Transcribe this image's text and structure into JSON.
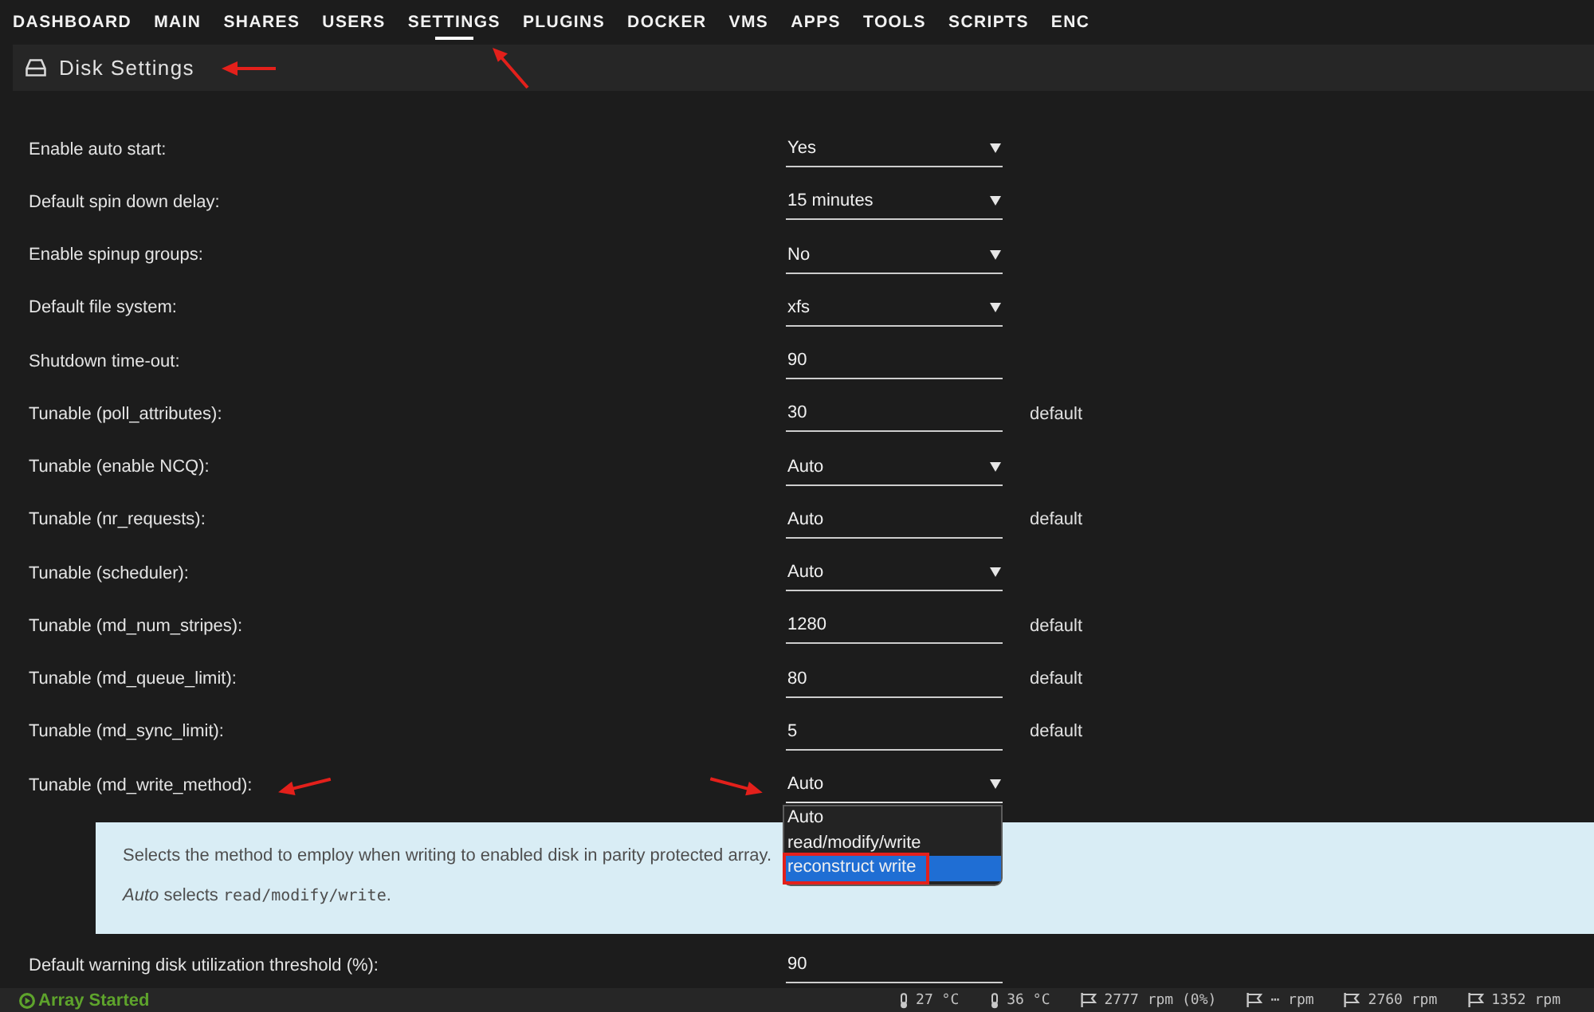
{
  "nav": {
    "items": [
      {
        "label": "DASHBOARD",
        "selected": false,
        "annotated": false
      },
      {
        "label": "MAIN",
        "selected": false,
        "annotated": false
      },
      {
        "label": "SHARES",
        "selected": false,
        "annotated": false
      },
      {
        "label": "USERS",
        "selected": false,
        "annotated": false
      },
      {
        "label": "SETTINGS",
        "selected": true,
        "annotated": true
      },
      {
        "label": "PLUGINS",
        "selected": false,
        "annotated": false
      },
      {
        "label": "DOCKER",
        "selected": false,
        "annotated": false
      },
      {
        "label": "VMS",
        "selected": false,
        "annotated": false
      },
      {
        "label": "APPS",
        "selected": false,
        "annotated": false
      },
      {
        "label": "TOOLS",
        "selected": false,
        "annotated": false
      },
      {
        "label": "SCRIPTS",
        "selected": false,
        "annotated": false
      },
      {
        "label": "ENC",
        "selected": false,
        "annotated": false
      }
    ]
  },
  "page_title": {
    "text": "Disk Settings",
    "annotated": true
  },
  "settings": [
    {
      "kind": "select",
      "label": "Enable auto start:",
      "value": "Yes",
      "expanded": false,
      "annotated": false
    },
    {
      "kind": "select",
      "label": "Default spin down delay:",
      "value": "15 minutes",
      "expanded": false,
      "annotated": false
    },
    {
      "kind": "select",
      "label": "Enable spinup groups:",
      "value": "No",
      "expanded": false,
      "annotated": false
    },
    {
      "kind": "select",
      "label": "Default file system:",
      "value": "xfs",
      "expanded": false,
      "annotated": false
    },
    {
      "kind": "text",
      "label": "Shutdown time-out:",
      "value": "90",
      "annotated": false
    },
    {
      "kind": "text",
      "label": "Tunable (poll_attributes):",
      "value": "30",
      "note": "default",
      "annotated": false
    },
    {
      "kind": "select",
      "label": "Tunable (enable NCQ):",
      "value": "Auto",
      "expanded": false,
      "annotated": false
    },
    {
      "kind": "text",
      "label": "Tunable (nr_requests):",
      "value": "Auto",
      "note": "default",
      "annotated": false
    },
    {
      "kind": "select",
      "label": "Tunable (scheduler):",
      "value": "Auto",
      "expanded": false,
      "annotated": false
    },
    {
      "kind": "text",
      "label": "Tunable (md_num_stripes):",
      "value": "1280",
      "note": "default",
      "annotated": false
    },
    {
      "kind": "text",
      "label": "Tunable (md_queue_limit):",
      "value": "80",
      "note": "default",
      "annotated": false
    },
    {
      "kind": "text",
      "label": "Tunable (md_sync_limit):",
      "value": "5",
      "note": "default",
      "annotated": false
    },
    {
      "kind": "select",
      "label": "Tunable (md_write_method):",
      "value": "Auto",
      "expanded": true,
      "annotated": true,
      "options": [
        {
          "label": "Auto",
          "highlighted": false,
          "annotated": false
        },
        {
          "label": "read/modify/write",
          "highlighted": false,
          "annotated": false
        },
        {
          "label": "reconstruct write",
          "highlighted": true,
          "annotated": true
        }
      ],
      "help": {
        "paragraphs": [
          {
            "parts": [
              {
                "kind": "plain",
                "text": "Selects the method to employ when writing to enabled disk in parity protected array."
              }
            ]
          },
          {
            "parts": [
              {
                "kind": "emphasis",
                "text": "Auto"
              },
              {
                "kind": "plain",
                "text": " selects "
              },
              {
                "kind": "code",
                "text": "read/modify/write"
              },
              {
                "kind": "plain",
                "text": "."
              }
            ]
          }
        ]
      }
    },
    {
      "kind": "text",
      "label": "Default warning disk utilization threshold (%):",
      "value": "90",
      "annotated": false
    }
  ],
  "status_bar": {
    "array_state": "Array Started",
    "sensors": [
      {
        "kind": "temperature",
        "reading": "27 °C"
      },
      {
        "kind": "temperature",
        "reading": "36 °C"
      },
      {
        "kind": "fan",
        "reading": "2777 rpm (0%)"
      },
      {
        "kind": "fan",
        "reading": "⋯ rpm"
      },
      {
        "kind": "fan",
        "reading": "2760 rpm"
      },
      {
        "kind": "fan",
        "reading": "1352 rpm"
      }
    ]
  }
}
